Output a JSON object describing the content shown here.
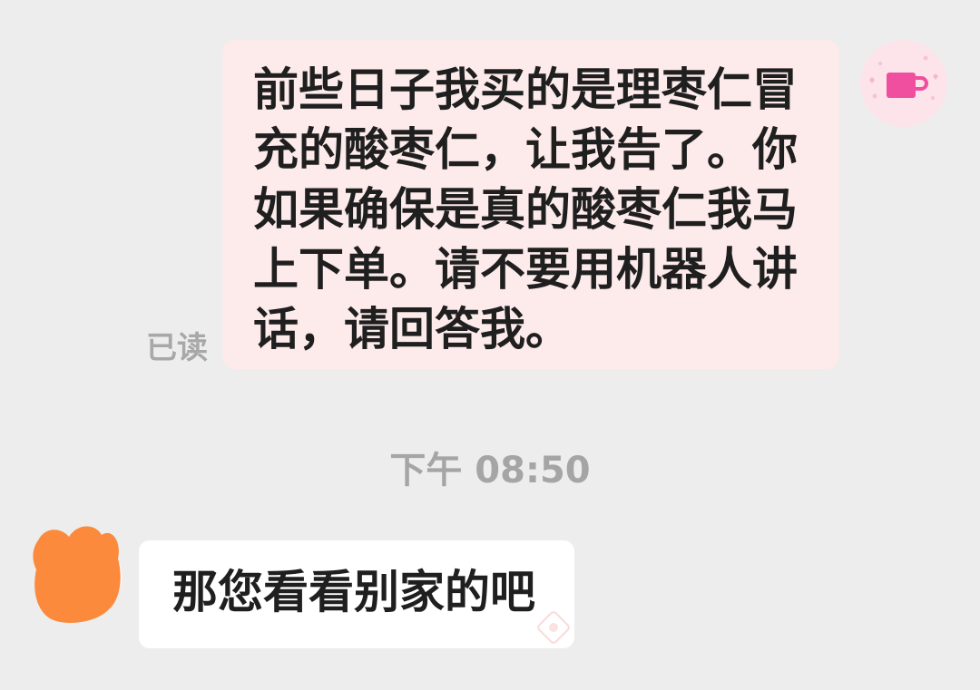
{
  "conversation": {
    "outgoing_message": {
      "text": "前些日子我买的是理枣仁冒充的酸枣仁，让我告了。你如果确保是真的酸枣仁我马上下单。请不要用机器人讲话，请回答我。",
      "status": "已读"
    },
    "timestamp": "下午 08:50",
    "incoming_message": {
      "text": "那您看看别家的吧"
    }
  },
  "icons": {
    "self_avatar": "pink-cup-icon",
    "other_avatar": "redacted-avatar",
    "incoming_badge": "badge-stamp-icon"
  },
  "colors": {
    "background": "#ededed",
    "outgoing_bubble": "#fdeaea",
    "incoming_bubble": "#ffffff",
    "text": "#1f1f1f",
    "meta_text": "#a5a5a5",
    "avatar_accent": "#f04fa0",
    "redaction": "#fb8a3c"
  }
}
